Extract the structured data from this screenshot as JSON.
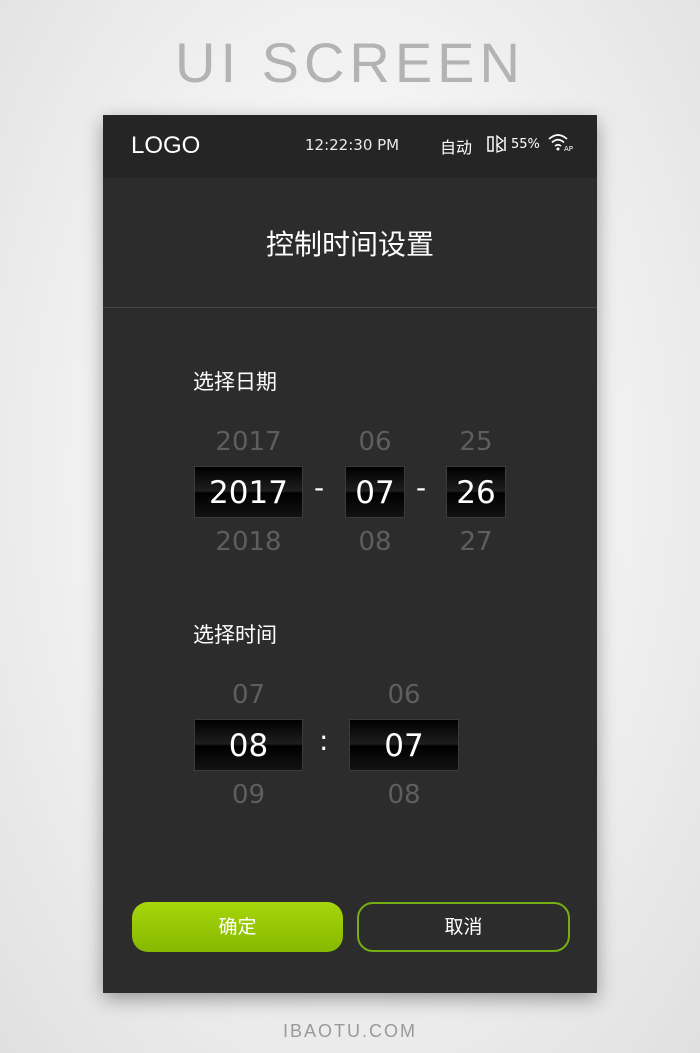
{
  "banner": {
    "title": "UI SCREEN",
    "footer": "IBAOTU.COM"
  },
  "status_bar": {
    "logo": "LOGO",
    "time": "12:22:30 PM",
    "mode": "自动",
    "battery": "55%",
    "wifi_badge": "AP",
    "icons": [
      "battery-icon",
      "wifi-icon"
    ]
  },
  "page": {
    "title": "控制时间设置"
  },
  "date_picker": {
    "label": "选择日期",
    "separator": "-",
    "year": {
      "prev": "2017",
      "current": "2017",
      "next": "2018"
    },
    "month": {
      "prev": "06",
      "current": "07",
      "next": "08"
    },
    "day": {
      "prev": "25",
      "current": "26",
      "next": "27"
    }
  },
  "time_picker": {
    "label": "选择时间",
    "separator": ":",
    "hour": {
      "prev": "07",
      "current": "08",
      "next": "09"
    },
    "minute": {
      "prev": "06",
      "current": "07",
      "next": "08"
    }
  },
  "actions": {
    "confirm": "确定",
    "cancel": "取消"
  },
  "colors": {
    "accent": "#94c600",
    "background": "#2c2c2c",
    "status_bar": "#252525",
    "faded_text": "#5e5e5e"
  }
}
